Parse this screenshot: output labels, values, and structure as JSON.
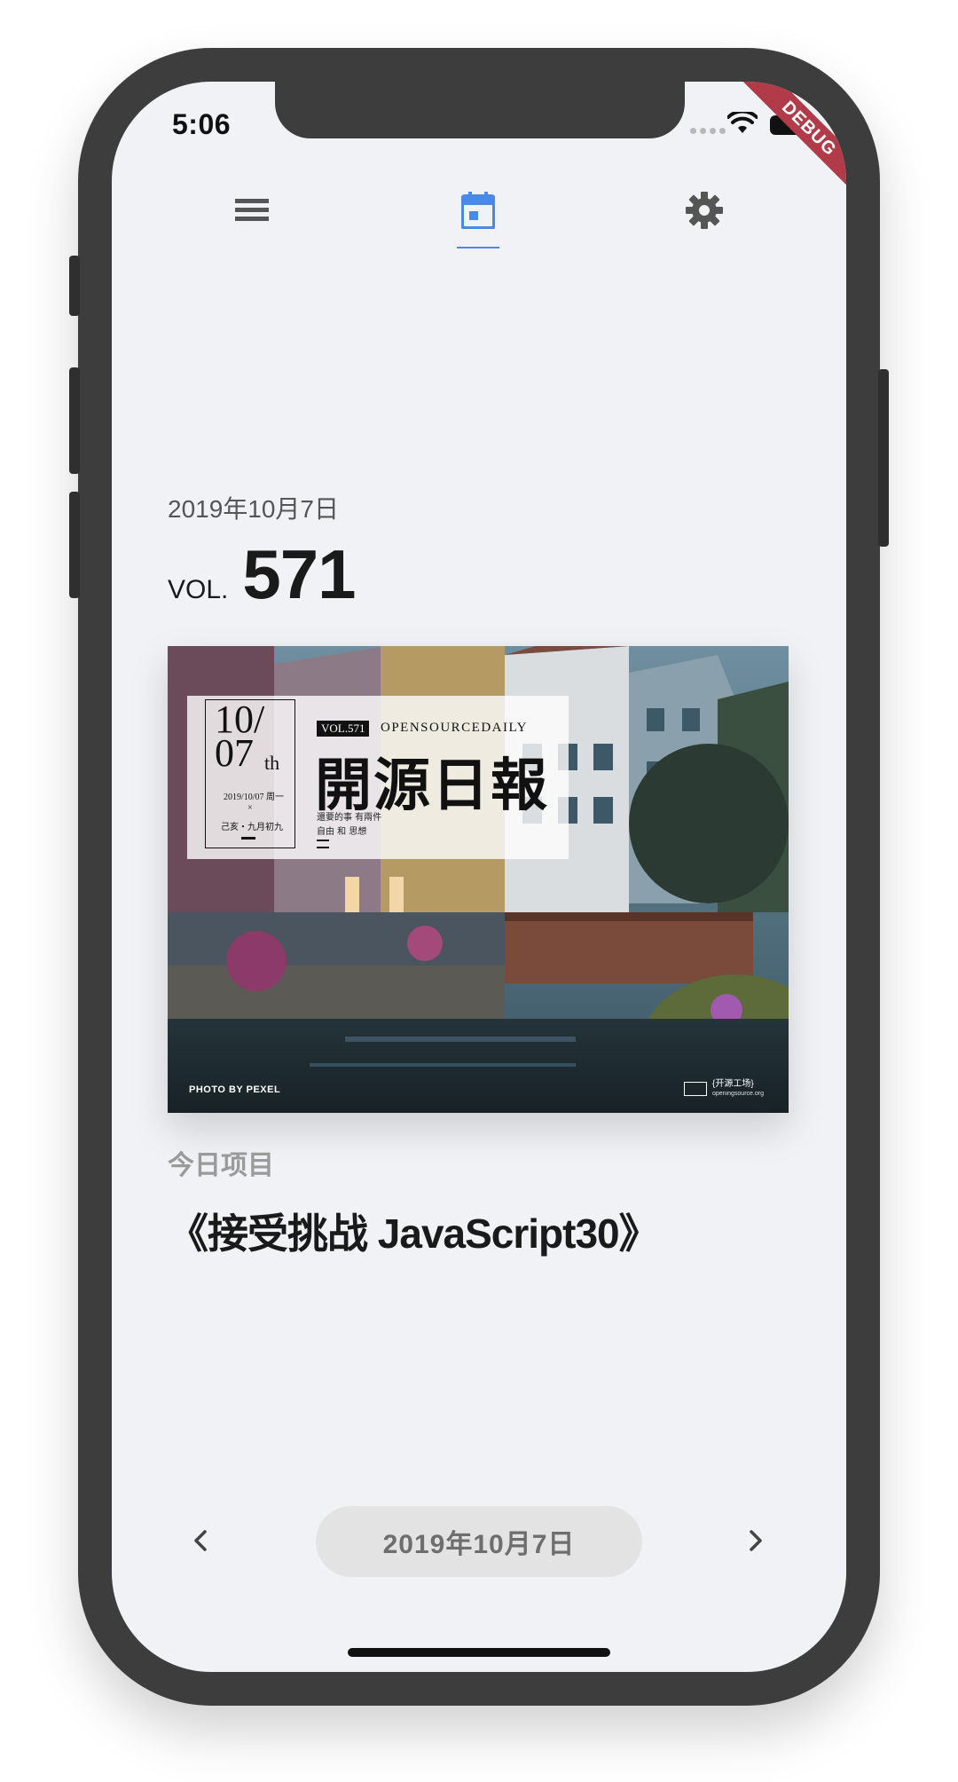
{
  "status_bar": {
    "time": "5:06",
    "debug_banner": "DEBUG"
  },
  "tabs": [
    {
      "icon": "list-icon",
      "active": false
    },
    {
      "icon": "calendar-icon",
      "active": true
    },
    {
      "icon": "settings-icon",
      "active": false
    }
  ],
  "issue": {
    "date": "2019年10月7日",
    "vol_label": "VOL.",
    "vol_number": "571"
  },
  "cover": {
    "day": "10/",
    "month": "07",
    "suffix": "th",
    "date_line": "2019/10/07 周一",
    "separator": "×",
    "lunar": "己亥・九月初九",
    "vol_tag": "VOL.571",
    "daily_text": "OPENSOURCEDAILY",
    "title": "開源日報",
    "motto_line1": "還要的事 有兩件",
    "motto_line2": "自由 和 思想",
    "photo_credit": "PHOTO BY PEXEL",
    "brand_name": "{开源工场}",
    "brand_url": "openingsource.org"
  },
  "project": {
    "label": "今日项目",
    "title": "《接受挑战 JavaScript30》"
  },
  "bottom_nav": {
    "date_label": "2019年10月7日",
    "prev_icon": "chevron-left-icon",
    "next_icon": "chevron-right-icon"
  },
  "colors": {
    "accent": "#4a89e8",
    "screen_bg": "#f1f2f5",
    "frame": "#3d3d3d",
    "debug_ribbon": "#b23b4a"
  }
}
